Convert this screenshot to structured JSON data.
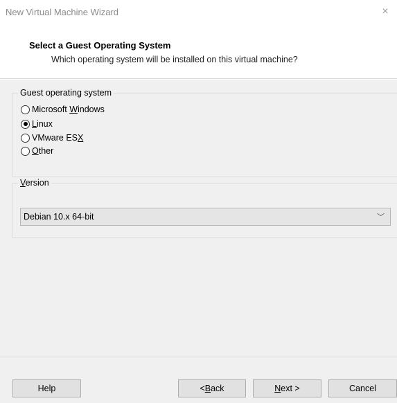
{
  "window": {
    "title": "New Virtual Machine Wizard",
    "close_glyph": "×"
  },
  "header": {
    "title": "Select a Guest Operating System",
    "subtitle": "Which operating system will be installed on this virtual machine?"
  },
  "guest_os": {
    "legend": "Guest operating system",
    "options": [
      {
        "pre": "Microsoft ",
        "ul": "W",
        "post": "indows",
        "checked": false
      },
      {
        "pre": "",
        "ul": "L",
        "post": "inux",
        "checked": true
      },
      {
        "pre": "VMware ES",
        "ul": "X",
        "post": "",
        "checked": false
      },
      {
        "pre": "",
        "ul": "O",
        "post": "ther",
        "checked": false
      }
    ]
  },
  "version": {
    "legend_ul": "V",
    "legend_rest": "ersion",
    "selected": "Debian 10.x 64-bit",
    "chevron": "﹀"
  },
  "buttons": {
    "help": "Help",
    "back_pre": "< ",
    "back_ul": "B",
    "back_post": "ack",
    "next_ul": "N",
    "next_post": "ext >",
    "cancel": "Cancel"
  }
}
